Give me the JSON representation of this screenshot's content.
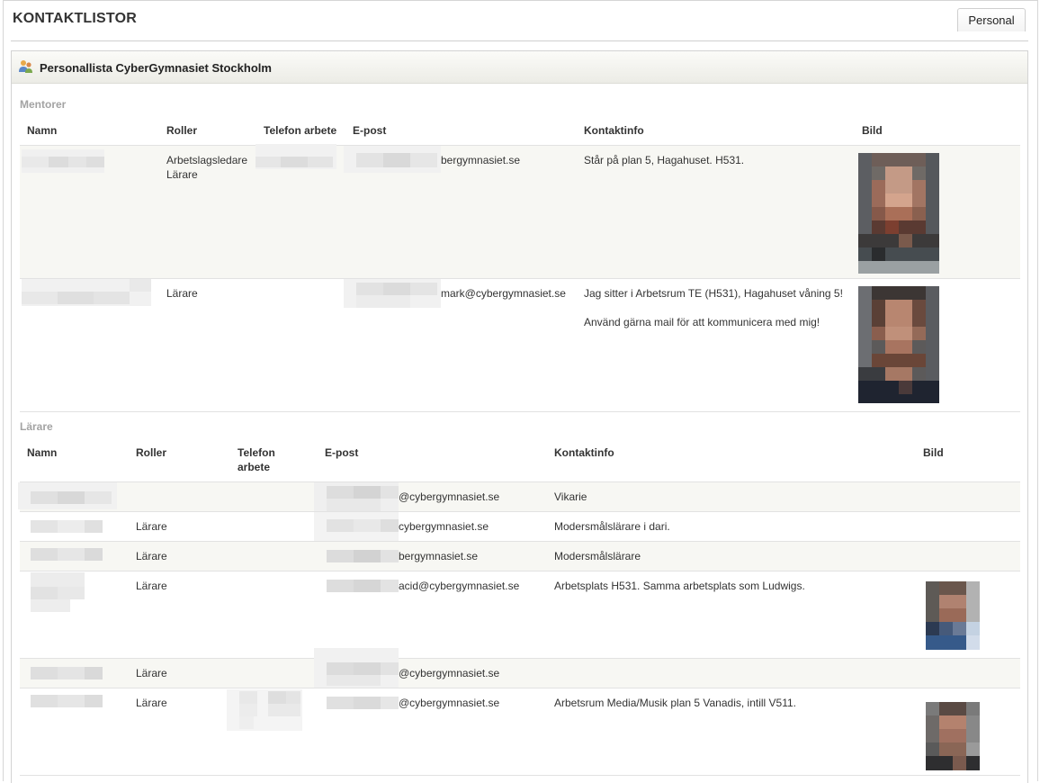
{
  "page": {
    "title": "KONTAKTLISTOR",
    "tab_label": "Personal"
  },
  "panel": {
    "title": "Personallista CyberGymnasiet Stockholm",
    "icon": "people-icon"
  },
  "mentorer": {
    "label": "Mentorer",
    "headers": {
      "namn": "Namn",
      "roller": "Roller",
      "telefon": "Telefon arbete",
      "epost": "E-post",
      "kontakt": "Kontaktinfo",
      "bild": "Bild"
    },
    "rows": [
      {
        "roller_1": "Arbetslagsledare",
        "roller_2": "Lärare",
        "epost": "bergymnasiet.se",
        "kontakt": "Står på plan 5, Hagahuset. H531."
      },
      {
        "roller_1": "Lärare",
        "epost": "mark@cybergymnasiet.se",
        "kontakt_1": "Jag sitter i Arbetsrum TE (H531), Hagahuset våning 5!",
        "kontakt_2": "Använd gärna mail för att kommunicera med mig!"
      }
    ]
  },
  "larare": {
    "label": "Lärare",
    "headers": {
      "namn": "Namn",
      "roller": "Roller",
      "telefon_1": "Telefon",
      "telefon_2": "arbete",
      "epost": "E-post",
      "kontakt": "Kontaktinfo",
      "bild": "Bild"
    },
    "rows": [
      {
        "roller": "",
        "epost": "@cybergymnasiet.se",
        "kontakt": "Vikarie"
      },
      {
        "roller": "Lärare",
        "epost": "cybergymnasiet.se",
        "kontakt": "Modersmålslärare i dari."
      },
      {
        "roller": "Lärare",
        "epost": "bergymnasiet.se",
        "kontakt": "Modersmålslärare"
      },
      {
        "roller": "Lärare",
        "epost": "acid@cybergymnasiet.se",
        "kontakt": "Arbetsplats H531. Samma arbetsplats som Ludwigs."
      },
      {
        "roller": "Lärare",
        "epost": "@cybergymnasiet.se",
        "kontakt": ""
      },
      {
        "roller": "Lärare",
        "epost": "@cybergymnasiet.se",
        "kontakt": "Arbetsrum Media/Musik plan 5 Vanadis, intill V511."
      }
    ]
  },
  "colors": {
    "row_alt": "#f7f7f3",
    "section_label": "#a3a3a3",
    "border": "#e2e2e2"
  }
}
